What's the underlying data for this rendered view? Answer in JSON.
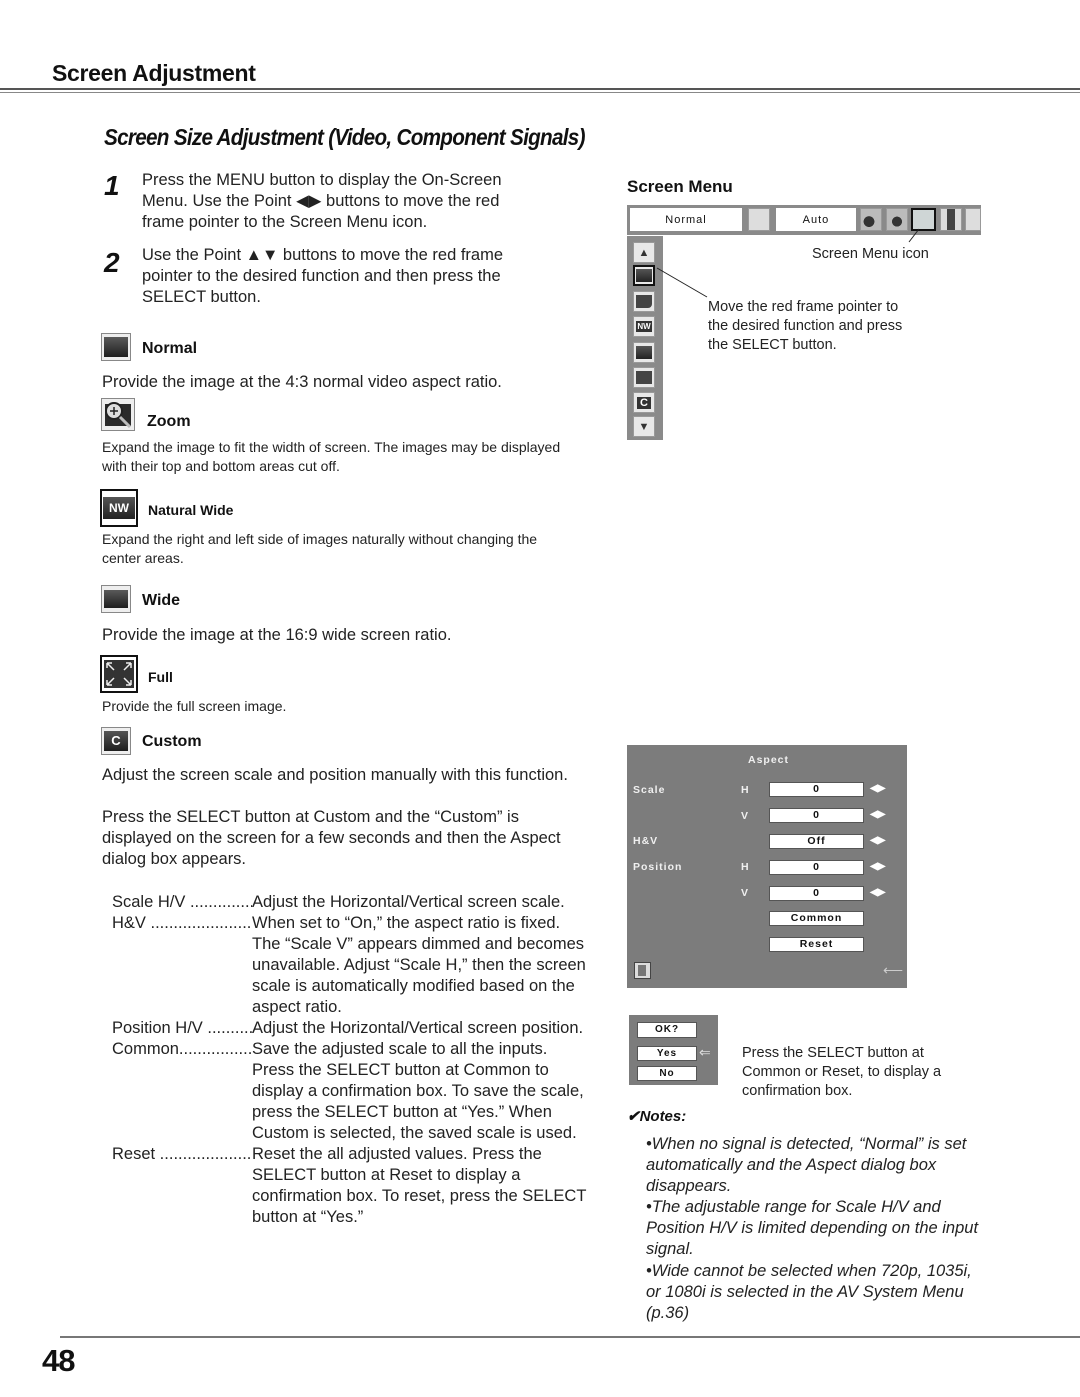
{
  "header": {
    "section_title": "Screen Adjustment",
    "subtitle": "Screen Size Adjustment (Video, Component Signals)"
  },
  "steps": [
    {
      "number": "1",
      "text": "Press the MENU button to display the On-Screen Menu. Use the Point ◀▶ buttons to move the red frame pointer to the Screen Menu icon."
    },
    {
      "number": "2",
      "text": "Use the Point ▲▼ buttons to move the red frame pointer to the desired function and then press the SELECT button."
    }
  ],
  "items": [
    {
      "icon": "normal-screen-icon",
      "label": "Normal",
      "description": "Provide the image at the 4:3 normal video aspect ratio."
    },
    {
      "icon": "zoom-icon",
      "label": "Zoom",
      "description": "Expand the image to fit the width of screen. The images may be displayed with their top and bottom areas cut off."
    },
    {
      "icon": "natural-wide-icon",
      "label": "Natural Wide",
      "glyph": "NW",
      "description": "Expand the right and left side of images naturally without changing the center areas."
    },
    {
      "icon": "wide-screen-icon",
      "label": "Wide",
      "description": "Provide the image at the 16:9 wide screen ratio."
    },
    {
      "icon": "full-screen-icon",
      "label": "Full",
      "description": "Provide the full screen image."
    },
    {
      "icon": "custom-icon",
      "label": "Custom",
      "glyph": "C",
      "description": "Adjust the screen scale and position manually with this function.",
      "description2": "Press the SELECT button at Custom and the “Custom” is displayed on the screen for a few seconds and then the Aspect dialog box appears."
    }
  ],
  "definitions": [
    {
      "term": "Scale H/V ..........................",
      "body": "Adjust the Horizontal/Vertical screen scale."
    },
    {
      "term": "H&V ..........................................",
      "body": "When set to “On,” the aspect ratio is fixed. The “Scale V” appears dimmed and becomes unavailable. Adjust “Scale H,” then the screen scale is automatically modified based on the aspect ratio."
    },
    {
      "term": "Position H/V ..........................",
      "body": "Adjust the Horizontal/Vertical screen position."
    },
    {
      "term": "Common..........................",
      "body": "Save the adjusted scale to all the inputs. Press the SELECT button at Common to display a confirmation box. To save the scale, press the SELECT button at “Yes.” When Custom is selected, the saved scale is used."
    },
    {
      "term": "Reset ..........................................",
      "body": "Reset the all adjusted values. Press the SELECT button at Reset to display a confirmation box. To reset, press the SELECT button at “Yes.”"
    }
  ],
  "screen_menu": {
    "title": "Screen Menu",
    "bar_field_1": "Normal",
    "bar_field_2": "Auto",
    "screen_menu_icon_label": "Screen Menu icon",
    "pointer_callout": "Move the red frame pointer to the desired function and press the SELECT button.",
    "side_up": "▲",
    "side_down": "▼",
    "side_nw": "NW",
    "side_c": "C"
  },
  "aspect_dialog": {
    "title": "Aspect",
    "scale_label": "Scale",
    "hv_label": "H&V",
    "position_label": "Position",
    "h": "H",
    "v": "V",
    "scale_h": "0",
    "scale_v": "0",
    "hv_value": "Off",
    "position_h": "0",
    "position_v": "0",
    "common": "Common",
    "reset": "Reset",
    "arrows": "◀▶",
    "back_arrow": "⟵"
  },
  "confirm_box": {
    "title": "OK?",
    "yes": "Yes",
    "no": "No",
    "pointer": "⇐",
    "callout": "Press the SELECT button at Common or Reset, to display a confirmation box."
  },
  "notes": {
    "title": "✔Notes:",
    "items": [
      "•When no signal is detected, “Normal” is set automatically and the Aspect dialog box disappears.",
      "•The adjustable range for Scale H/V and Position H/V is limited depending on the input signal.",
      "•Wide cannot be selected when 720p, 1035i, or 1080i is selected in the AV System Menu (p.36)"
    ]
  },
  "page_number": "48"
}
